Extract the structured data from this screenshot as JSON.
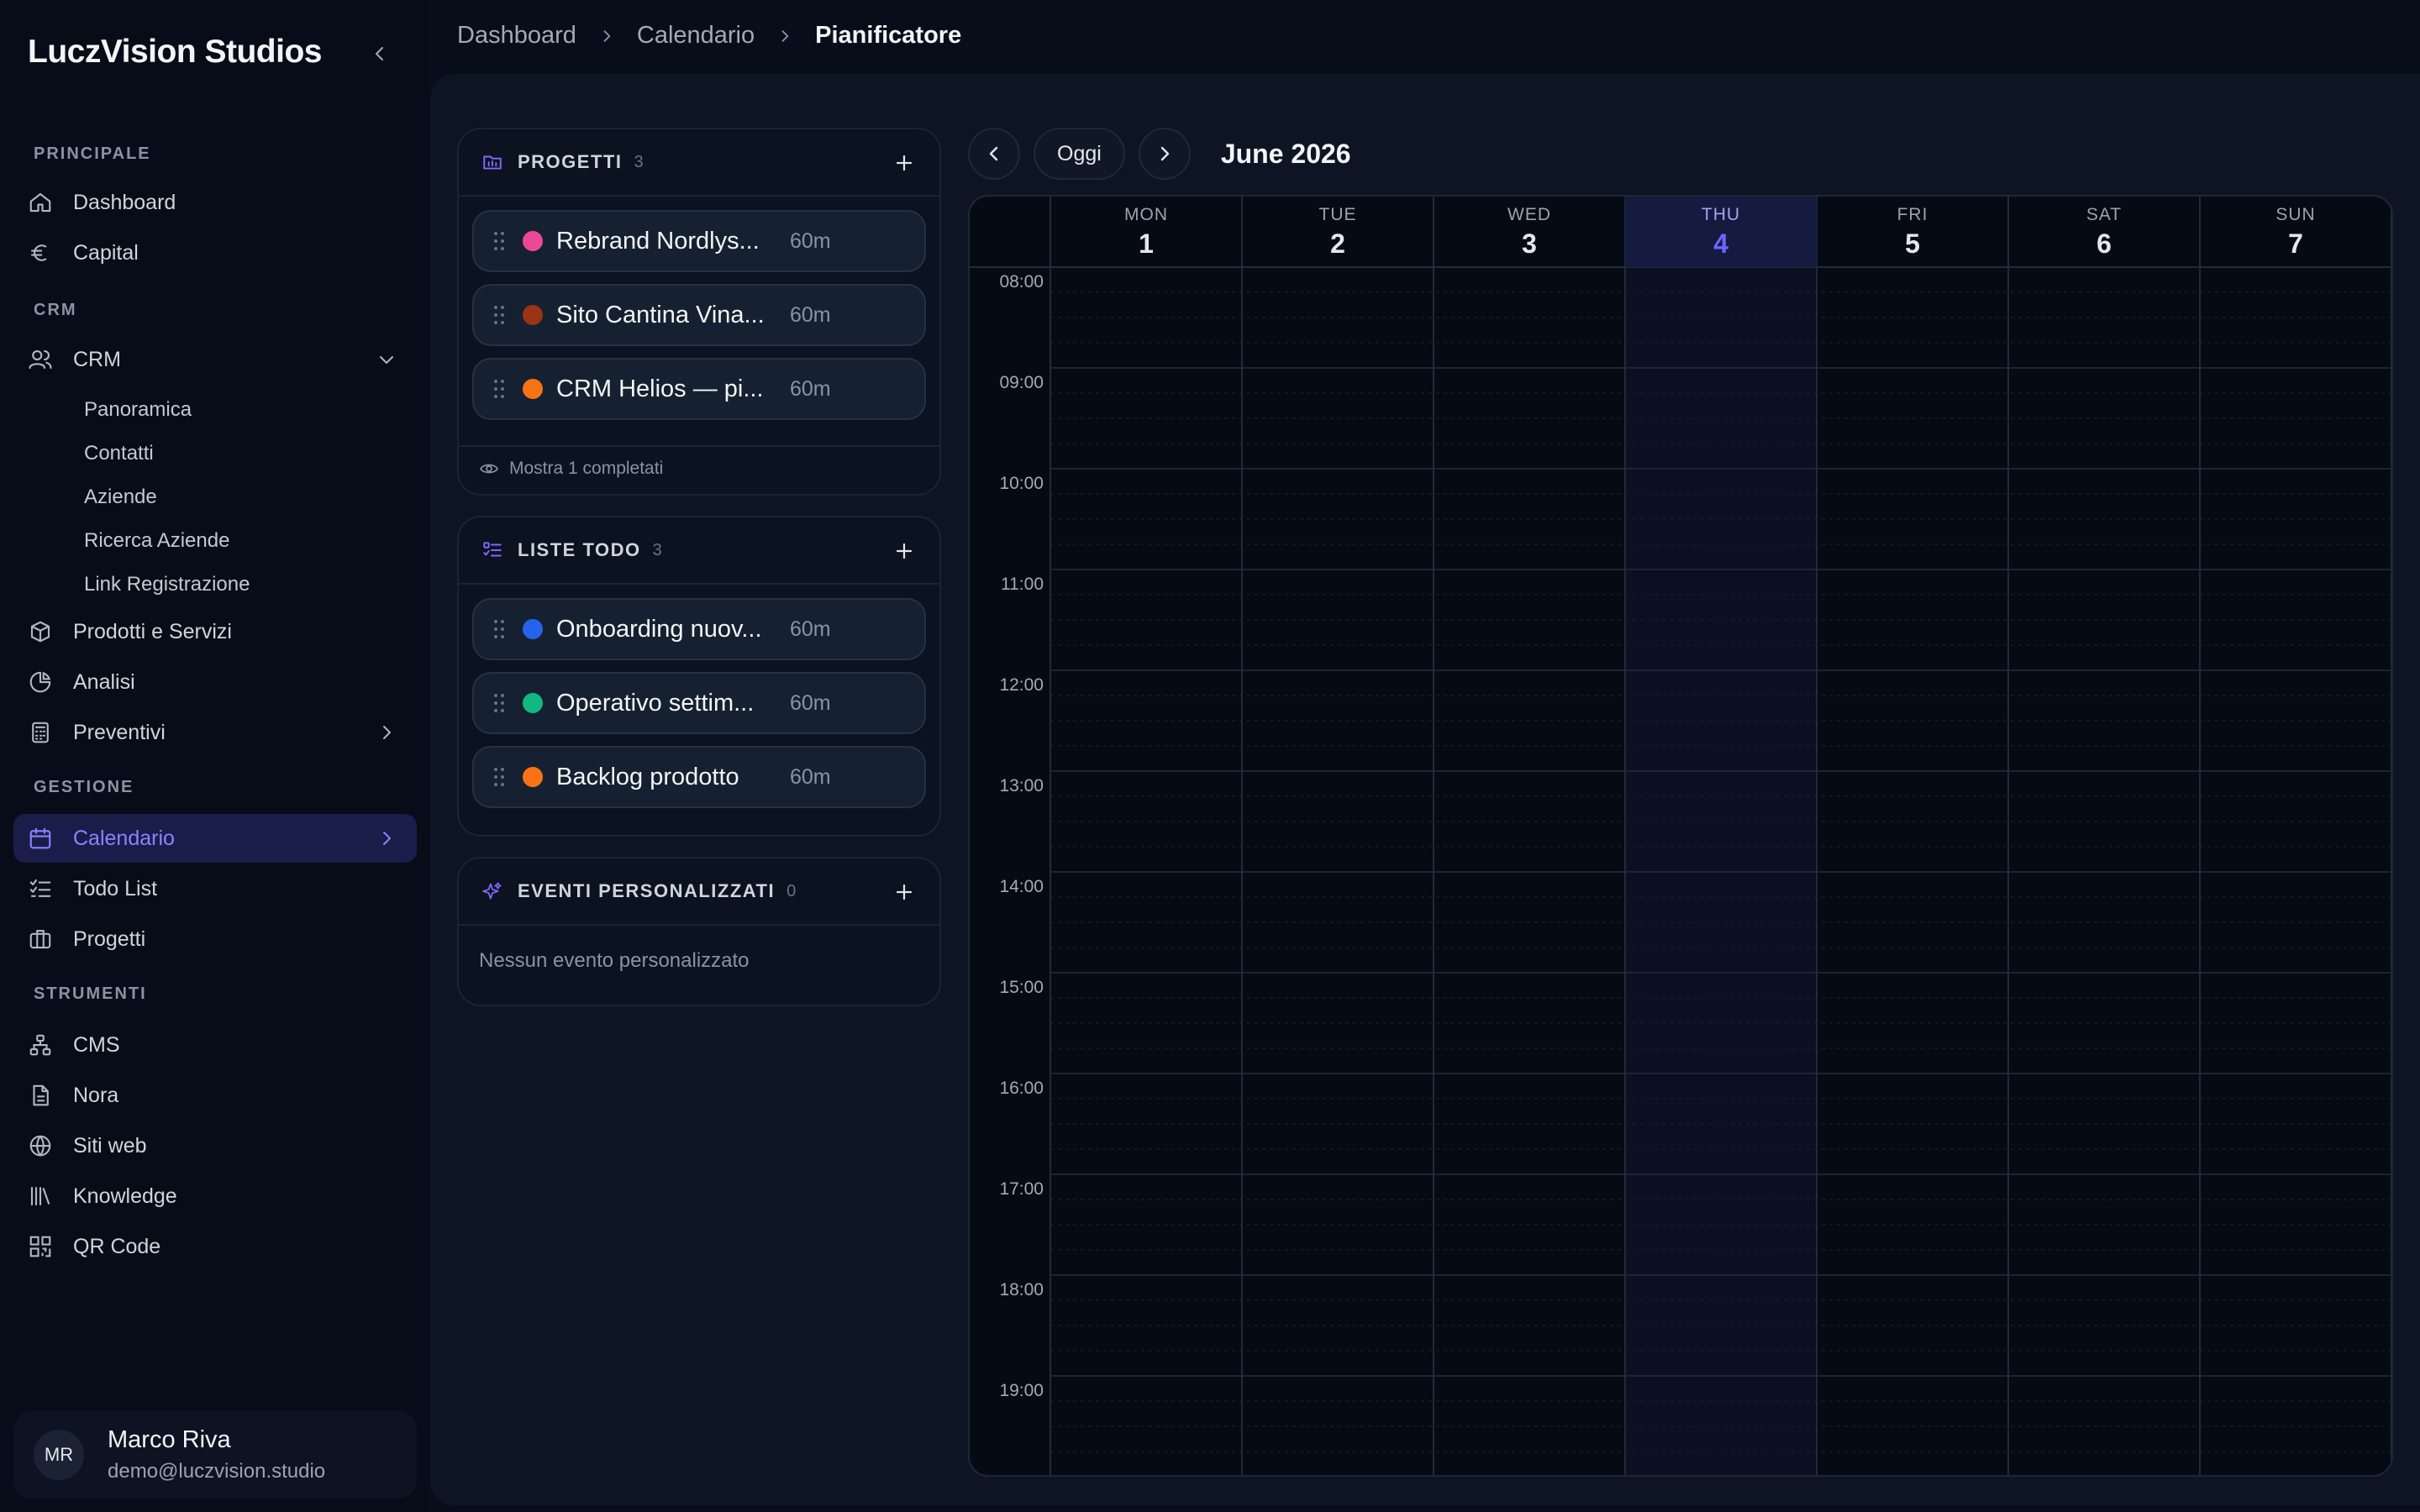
{
  "sidebar": {
    "brand": "LuczVision Studios",
    "sections": {
      "principale": "PRINCIPALE",
      "crm": "CRM",
      "gestione": "GESTIONE",
      "strumenti": "STRUMENTI"
    },
    "items": {
      "dashboard": "Dashboard",
      "capital": "Capital",
      "crm": "CRM",
      "prodotti": "Prodotti e Servizi",
      "analisi": "Analisi",
      "preventivi": "Preventivi",
      "calendario": "Calendario",
      "todo": "Todo List",
      "progetti": "Progetti",
      "cms": "CMS",
      "nora": "Nora",
      "siti": "Siti web",
      "knowledge": "Knowledge",
      "qr": "QR Code"
    },
    "crm_sub": [
      "Panoramica",
      "Contatti",
      "Aziende",
      "Ricerca Aziende",
      "Link Registrazione"
    ],
    "user": {
      "initials": "MR",
      "name": "Marco Riva",
      "email": "demo@luczvision.studio"
    }
  },
  "breadcrumb": [
    "Dashboard",
    "Calendario",
    "Pianificatore"
  ],
  "panels": {
    "progetti": {
      "title": "PROGETTI",
      "count": "3",
      "tasks": [
        {
          "name": "Rebrand Nordlys...",
          "duration": "60m",
          "color": "#ec4899"
        },
        {
          "name": "Sito Cantina Vina...",
          "duration": "60m",
          "color": "#9a3412"
        },
        {
          "name": "CRM Helios — pi...",
          "duration": "60m",
          "color": "#f97316"
        }
      ],
      "footer": "Mostra 1 completati"
    },
    "todo": {
      "title": "LISTE TODO",
      "count": "3",
      "tasks": [
        {
          "name": "Onboarding nuov...",
          "duration": "60m",
          "color": "#2563eb"
        },
        {
          "name": "Operativo settim...",
          "duration": "60m",
          "color": "#10b981"
        },
        {
          "name": "Backlog prodotto",
          "duration": "60m",
          "color": "#f97316"
        }
      ]
    },
    "eventi": {
      "title": "EVENTI PERSONALIZZATI",
      "count": "0",
      "empty": "Nessun evento personalizzato"
    }
  },
  "calendar": {
    "today_label": "Oggi",
    "month": "June 2026",
    "days": [
      {
        "name": "MON",
        "num": "1"
      },
      {
        "name": "TUE",
        "num": "2"
      },
      {
        "name": "WED",
        "num": "3"
      },
      {
        "name": "THU",
        "num": "4",
        "today": true
      },
      {
        "name": "FRI",
        "num": "5"
      },
      {
        "name": "SAT",
        "num": "6"
      },
      {
        "name": "SUN",
        "num": "7"
      }
    ],
    "hours": [
      "08:00",
      "09:00",
      "10:00",
      "11:00",
      "12:00",
      "13:00",
      "14:00",
      "15:00",
      "16:00",
      "17:00",
      "18:00",
      "19:00"
    ]
  },
  "colors": {
    "accent": "#6d63ff",
    "active_bg": "#1a1d4a"
  }
}
